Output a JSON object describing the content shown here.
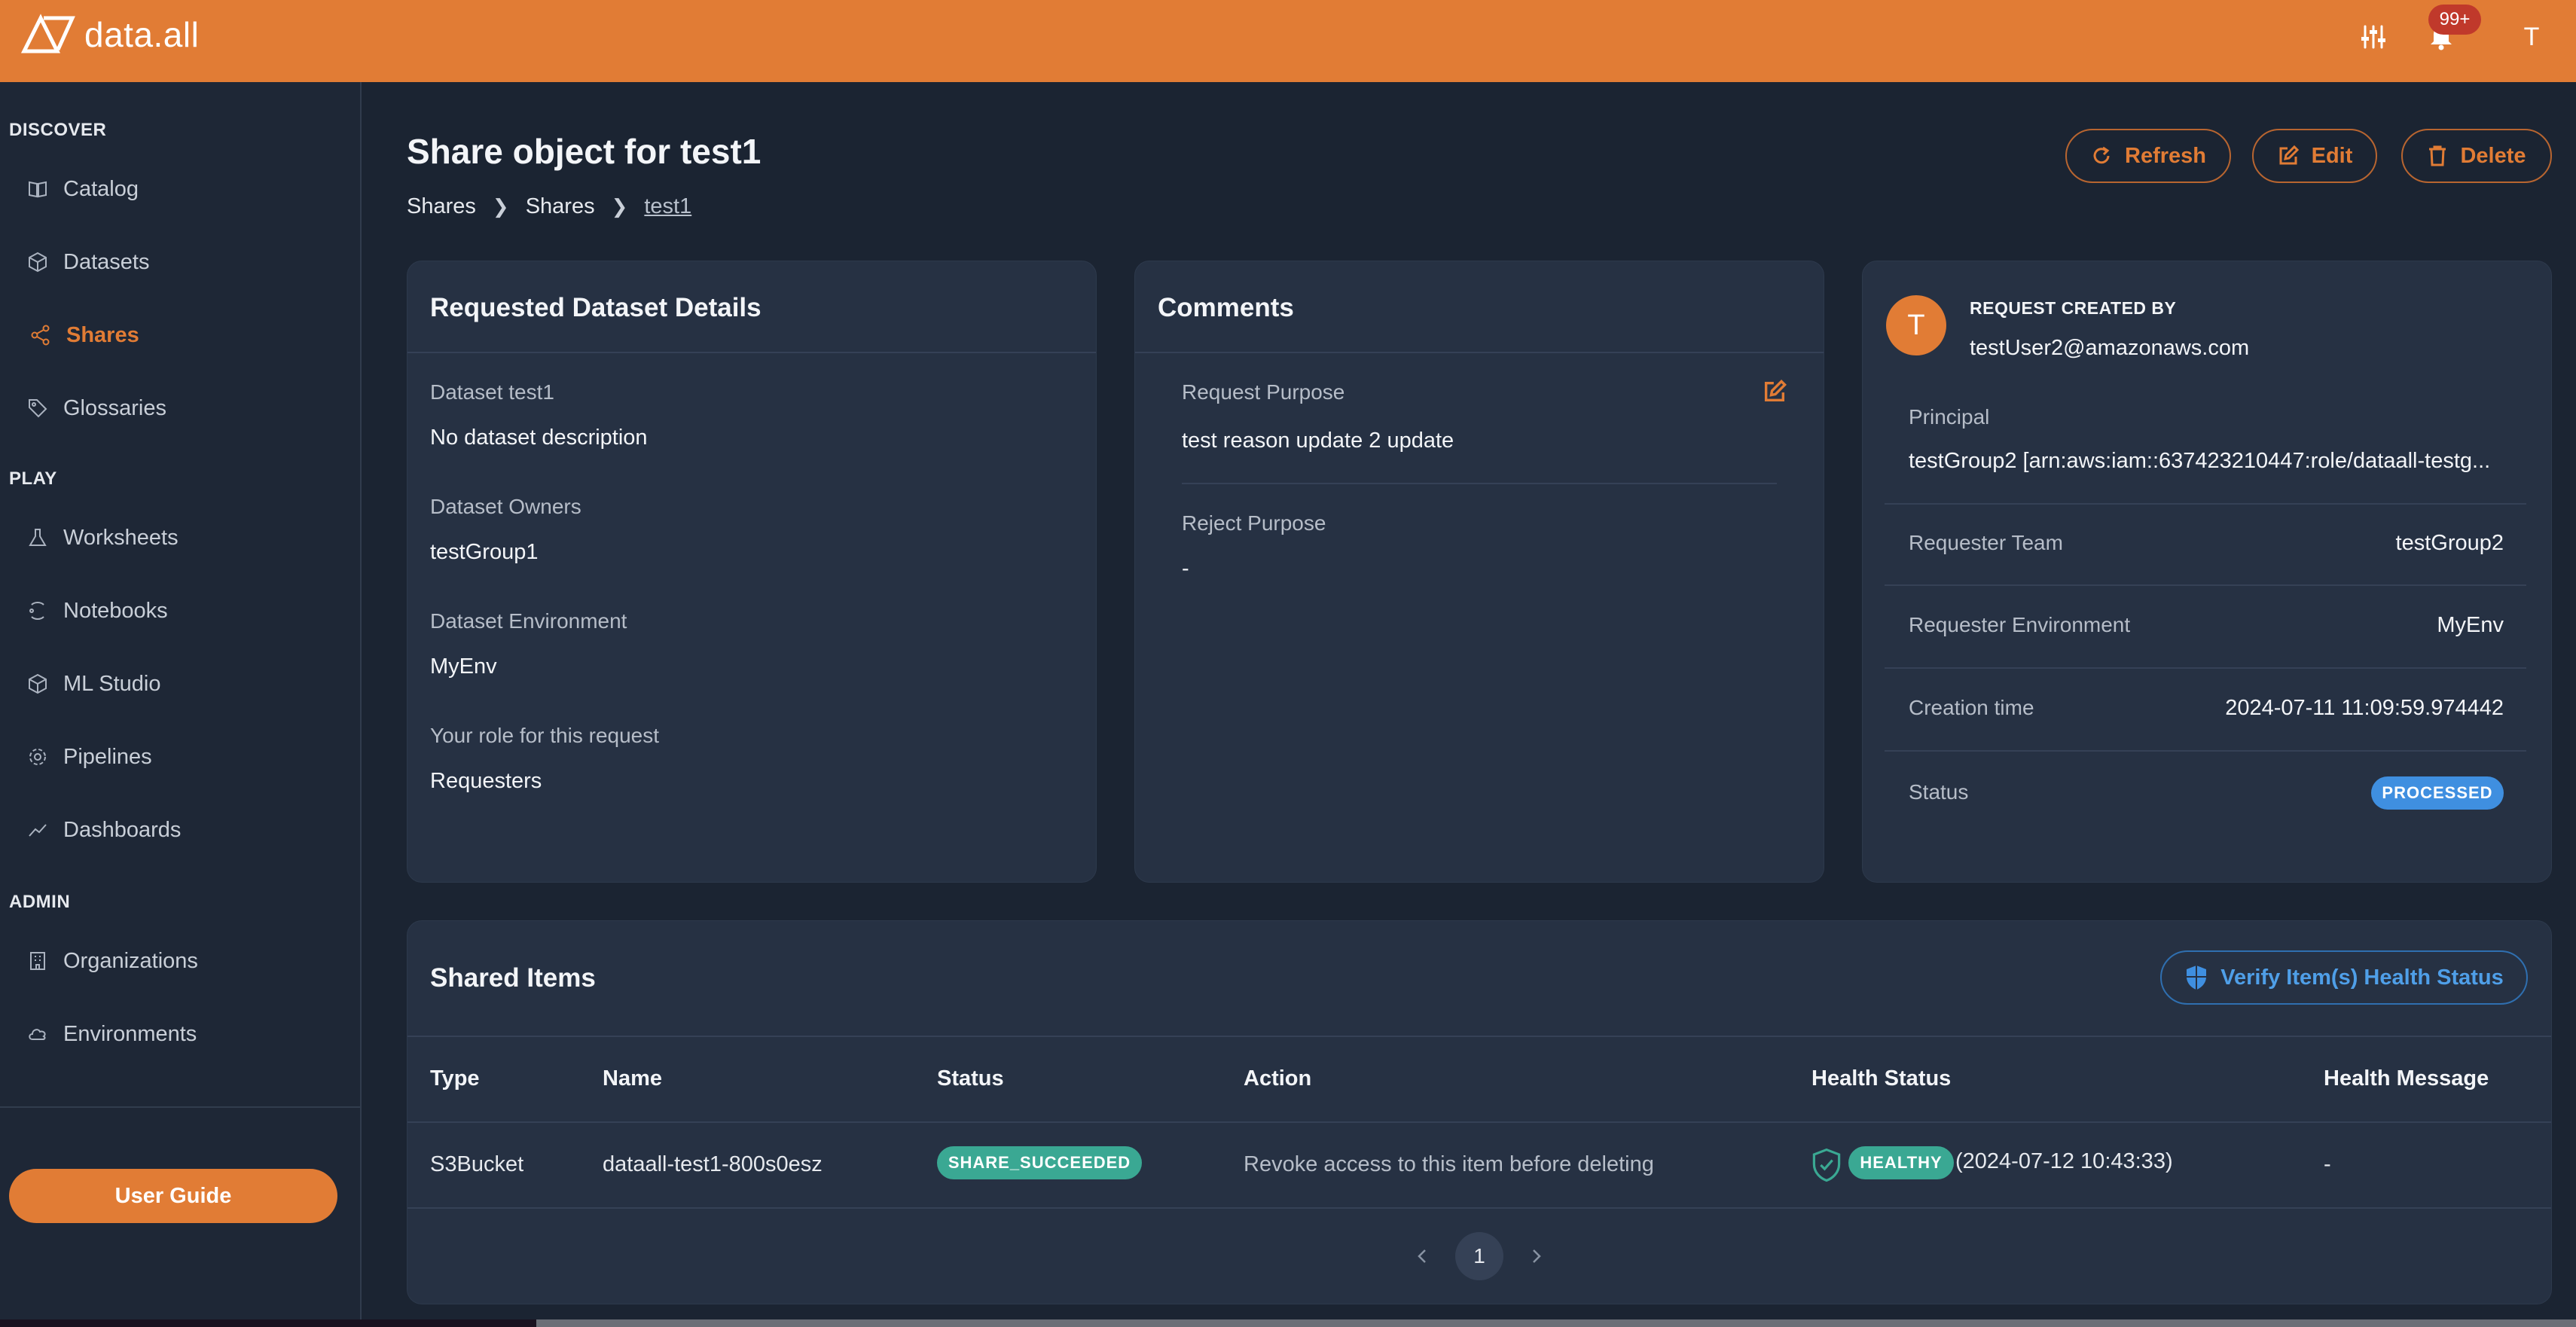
{
  "app": {
    "name": "data.all",
    "notification_count": "99+",
    "user_initial": "T"
  },
  "sidebar": {
    "sections": {
      "discover": "DISCOVER",
      "play": "PLAY",
      "admin": "ADMIN"
    },
    "items": {
      "catalog": "Catalog",
      "datasets": "Datasets",
      "shares": "Shares",
      "glossaries": "Glossaries",
      "worksheets": "Worksheets",
      "notebooks": "Notebooks",
      "ml_studio": "ML Studio",
      "pipelines": "Pipelines",
      "dashboards": "Dashboards",
      "organizations": "Organizations",
      "environments": "Environments"
    },
    "user_guide_label": "User Guide"
  },
  "page": {
    "title": "Share object for test1",
    "breadcrumb": [
      "Shares",
      "Shares",
      "test1"
    ],
    "buttons": {
      "refresh": "Refresh",
      "edit": "Edit",
      "delete": "Delete"
    }
  },
  "dataset_details": {
    "title": "Requested Dataset Details",
    "dataset_label": "Dataset test1",
    "dataset_description": "No dataset description",
    "owners_label": "Dataset Owners",
    "owners_value": "testGroup1",
    "environment_label": "Dataset Environment",
    "environment_value": "MyEnv",
    "role_label": "Your role for this request",
    "role_value": "Requesters"
  },
  "comments": {
    "title": "Comments",
    "request_purpose_label": "Request Purpose",
    "request_purpose_value": "test reason update 2 update",
    "reject_purpose_label": "Reject Purpose",
    "reject_purpose_value": "-"
  },
  "request_info": {
    "avatar_initial": "T",
    "created_by_label": "REQUEST CREATED BY",
    "created_by_value": "testUser2@amazonaws.com",
    "principal_label": "Principal",
    "principal_value": "testGroup2 [arn:aws:iam::637423210447:role/dataall-testg...",
    "requester_team_label": "Requester Team",
    "requester_team_value": "testGroup2",
    "requester_env_label": "Requester Environment",
    "requester_env_value": "MyEnv",
    "creation_time_label": "Creation time",
    "creation_time_value": "2024-07-11 11:09:59.974442",
    "status_label": "Status",
    "status_value": "PROCESSED"
  },
  "shared_items": {
    "title": "Shared Items",
    "verify_button": "Verify Item(s) Health Status",
    "columns": [
      "Type",
      "Name",
      "Status",
      "Action",
      "Health Status",
      "Health Message"
    ],
    "rows": [
      {
        "type": "S3Bucket",
        "name": "dataall-test1-800s0esz",
        "status": "SHARE_SUCCEEDED",
        "action": "Revoke access to this item before deleting",
        "health_status": "HEALTHY",
        "health_time": "(2024-07-12 10:43:33)",
        "health_message": "-"
      }
    ],
    "pagination": {
      "current_page": "1"
    }
  },
  "colors": {
    "accent": "#e17c35",
    "background": "#1b2432",
    "card": "#263143",
    "status_blue": "#3f8fe0",
    "status_green": "#3aa893"
  }
}
